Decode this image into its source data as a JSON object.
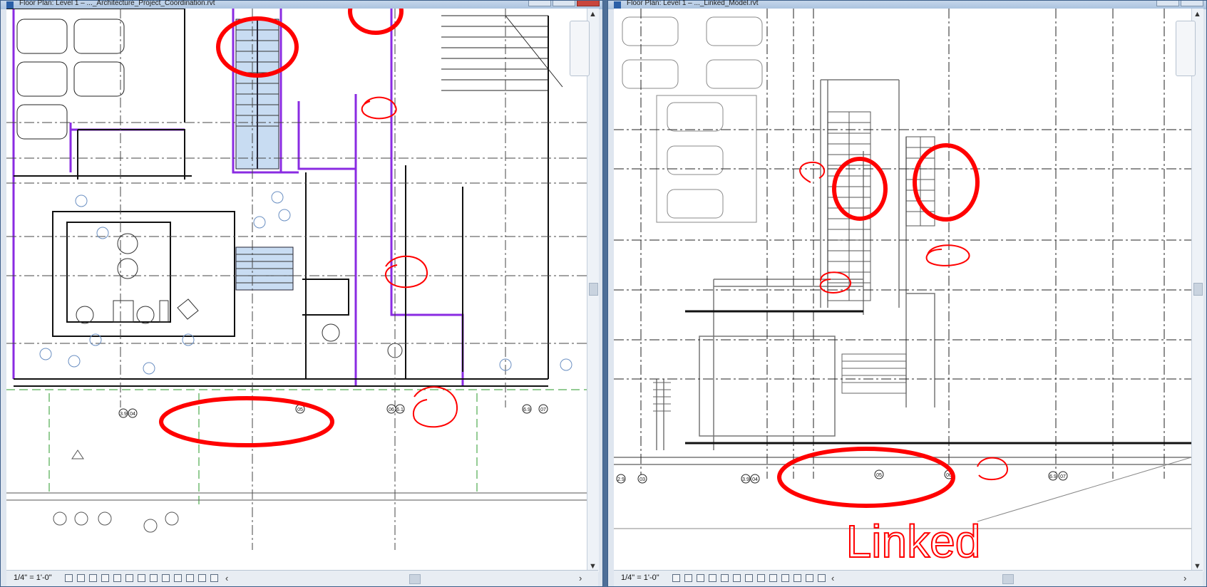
{
  "left_window": {
    "title": "Floor Plan: Level 1 – ..._Architecture_Project_Coordination.rvt",
    "scale": "1/4\" = 1'-0\"",
    "grid_bubbles": [
      "3.9",
      "04",
      "05",
      "06",
      "6.1",
      "6.9",
      "07"
    ]
  },
  "right_window": {
    "title": "Floor Plan: Level 1 – ..._Linked_Model.rvt",
    "scale": "1/4\" = 1'-0\"",
    "grid_bubbles": [
      "2.9",
      "03",
      "3.9",
      "04",
      "05",
      "06",
      "6.9",
      "07"
    ],
    "annotation": "Linked"
  },
  "colors": {
    "markup": "#ff0000",
    "room_boundary": "#8a2be2",
    "stair_fill": "#c8dcf2",
    "grid_line": "#2a9a2a"
  }
}
